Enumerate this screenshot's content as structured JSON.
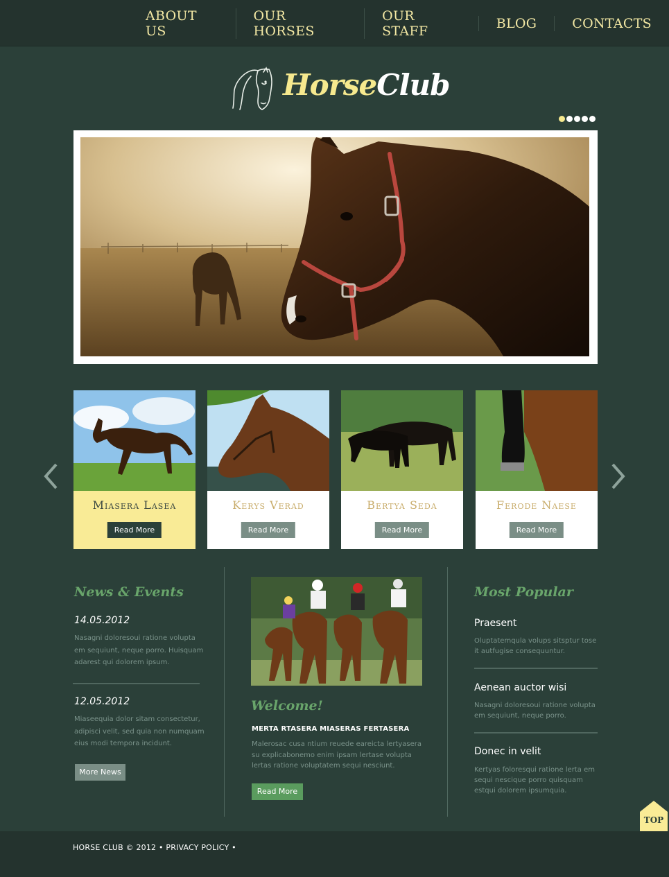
{
  "nav": {
    "items": [
      {
        "label": "ABOUT US"
      },
      {
        "label": "OUR HORSES"
      },
      {
        "label": "OUR STAFF"
      },
      {
        "label": "BLOG"
      },
      {
        "label": "CONTACTS"
      }
    ]
  },
  "logo": {
    "part1": "Horse",
    "part2": "Club"
  },
  "slider": {
    "dots": 5,
    "active": 0
  },
  "cards": [
    {
      "name": "Miasera Lasea",
      "button": "Read More",
      "active": true
    },
    {
      "name": "Kerys Verad",
      "button": "Read More",
      "active": false
    },
    {
      "name": "Bertya Seda",
      "button": "Read More",
      "active": false
    },
    {
      "name": "Ferode Naese",
      "button": "Read More",
      "active": false
    }
  ],
  "news": {
    "title": "News & Events",
    "items": [
      {
        "date": "14.05.2012",
        "text": "Nasagni doloresoui ratione volupta em sequiunt, neque porro. Huisquam adarest qui dolorem ipsum."
      },
      {
        "date": "12.05.2012",
        "text": "Miaseequia dolor sitam consectetur, adipisci velit, sed quia non numquam eius modi tempora incidunt."
      }
    ],
    "button": "More News"
  },
  "welcome": {
    "title": "Welcome!",
    "subtitle": "MERTA RTASERA MIASERAS FERTASERA",
    "text": "Malerosac cusa ntium reuede eareicta lertyasera su explicabonemo enim ipsam lertase volupta lertas ratione voluptatem sequi nesciunt.",
    "button": "Read More"
  },
  "popular": {
    "title": "Most Popular",
    "items": [
      {
        "title": "Praesent",
        "text": "Oluptatemqula volups sitsptur tose it autfugise consequuntur."
      },
      {
        "title": "Aenean auctor wisi",
        "text": "Nasagni doloresoui ratione volupta em sequiunt, neque porro."
      },
      {
        "title": "Donec in velit",
        "text": "Kertyas foloresqui ratione lerta em sequi nescique porro quisquam estqui dolorem ipsumquia."
      }
    ]
  },
  "top_button": "TOP",
  "footer": {
    "copyright": "HORSE CLUB © 2012",
    "sep": "•",
    "privacy": "PRIVACY POLICY"
  },
  "colors": {
    "bg": "#2b4039",
    "accent_yellow": "#f9eb96",
    "accent_green": "#5a9c5e"
  }
}
